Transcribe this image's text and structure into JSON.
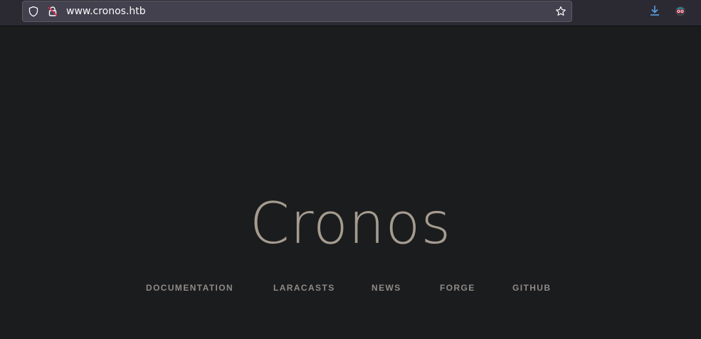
{
  "browser": {
    "url": "www.cronos.htb",
    "icons": {
      "tracking_protection": "shield-icon",
      "connection": "insecure-lock-icon",
      "bookmark": "star-icon",
      "downloads": "download-icon",
      "extension": "extension-avatar-icon"
    }
  },
  "page": {
    "title": "Cronos",
    "links": [
      {
        "label": "DOCUMENTATION"
      },
      {
        "label": "LARACASTS"
      },
      {
        "label": "NEWS"
      },
      {
        "label": "FORGE"
      },
      {
        "label": "GITHUB"
      }
    ]
  },
  "colors": {
    "page_background": "#1b1c1e",
    "title": "#a59b8f",
    "links": "#8f8a86",
    "toolbar": "#2b2a33",
    "download_accent": "#5aa0e6",
    "insecure_accent": "#e22850"
  }
}
